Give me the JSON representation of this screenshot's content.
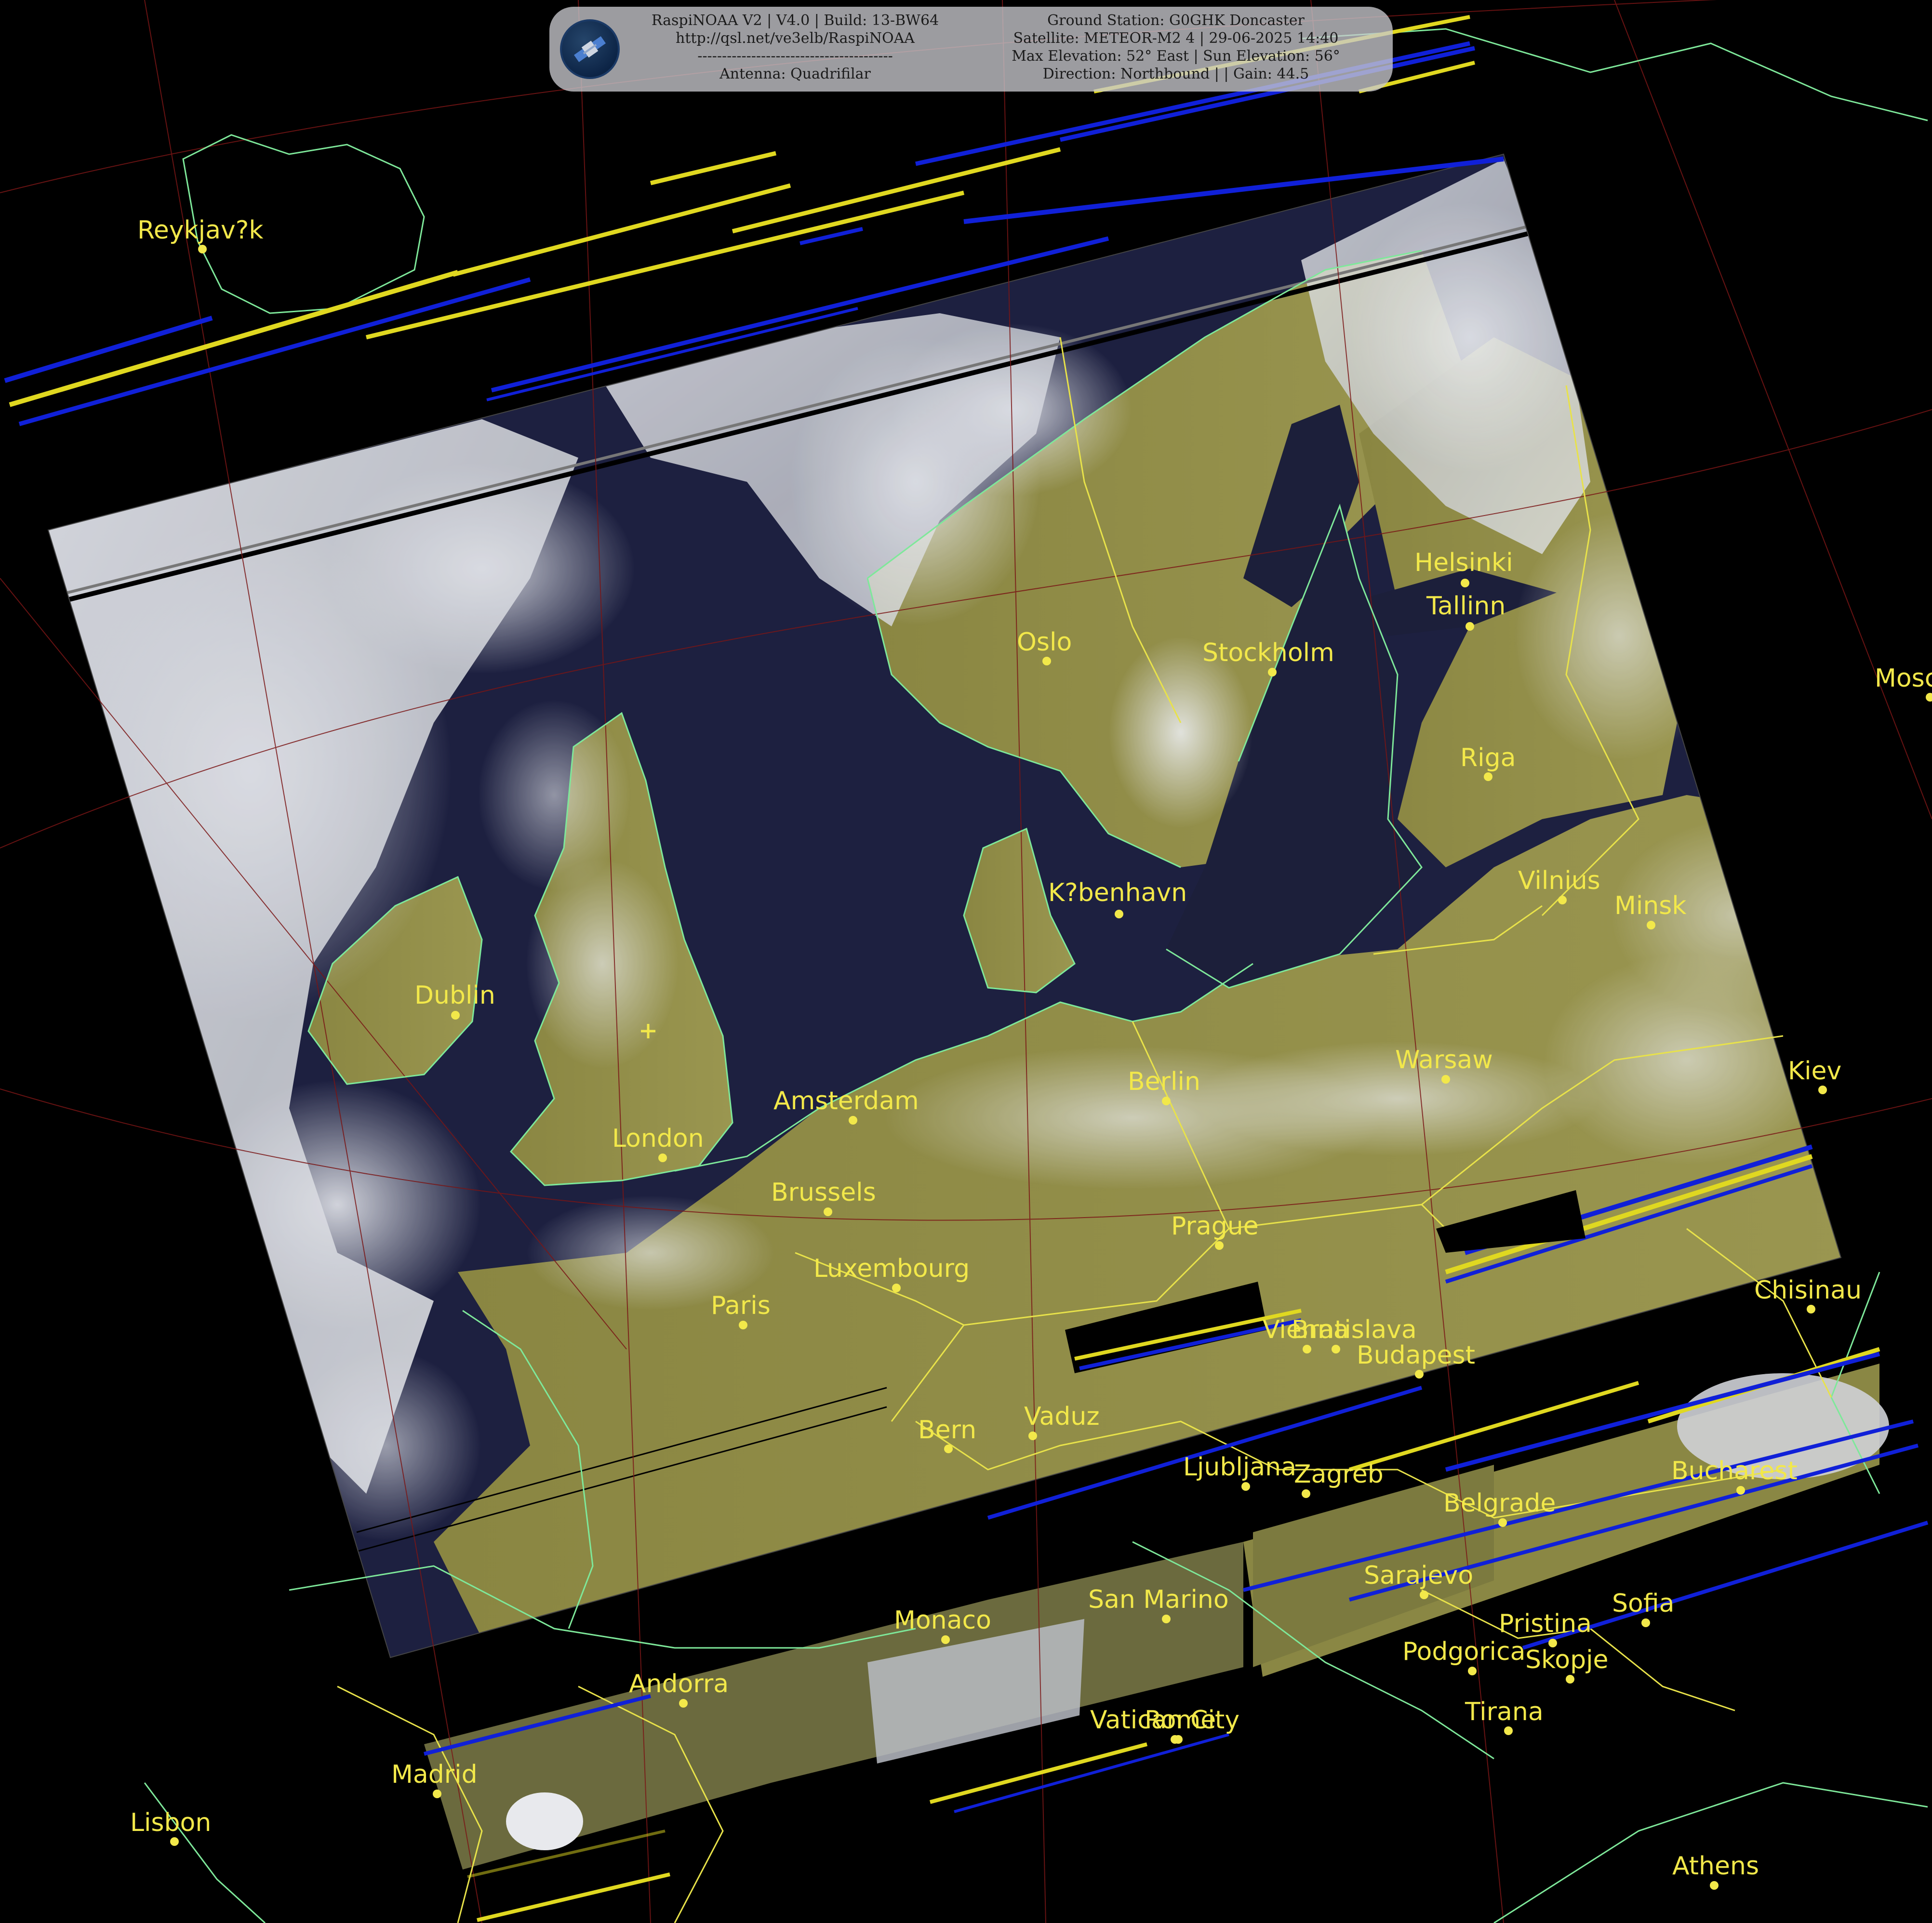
{
  "header": {
    "left_lines": [
      "RaspiNOAA V2 | V4.0 | Build: 13-BW64",
      "http://qsl.net/ve3elb/RaspiNOAA",
      "----------------------------------------",
      "Antenna: Quadrifilar"
    ],
    "right_lines": [
      "Ground Station: G0GHK Doncaster",
      "Satellite: METEOR-M2 4 | 29-06-2025 14:40",
      "Max Elevation: 52° East | Sun Elevation: 56°",
      "Direction: Northbound | | Gain: 44.5"
    ],
    "logo_icon": "satellite-icon"
  },
  "cities": [
    {
      "name": "Reykjav?k"
    },
    {
      "name": "Helsinki"
    },
    {
      "name": "Tallinn"
    },
    {
      "name": "Oslo"
    },
    {
      "name": "Stockholm"
    },
    {
      "name": "Mosc"
    },
    {
      "name": "Riga"
    },
    {
      "name": "Vilnius"
    },
    {
      "name": "Minsk"
    },
    {
      "name": "K?benhavn"
    },
    {
      "name": "Dublin"
    },
    {
      "name": "Warsaw"
    },
    {
      "name": "Kiev"
    },
    {
      "name": "Amsterdam"
    },
    {
      "name": "Berlin"
    },
    {
      "name": "London"
    },
    {
      "name": "Brussels"
    },
    {
      "name": "Prague"
    },
    {
      "name": "Luxembourg"
    },
    {
      "name": "Chisinau"
    },
    {
      "name": "Paris"
    },
    {
      "name": "Vienna"
    },
    {
      "name": "Bratislava"
    },
    {
      "name": "Budapest"
    },
    {
      "name": "Bern"
    },
    {
      "name": "Vaduz"
    },
    {
      "name": "Ljubljana"
    },
    {
      "name": "Zagreb"
    },
    {
      "name": "Bucharest"
    },
    {
      "name": "Belgrade"
    },
    {
      "name": "Sarajevo"
    },
    {
      "name": "Monaco"
    },
    {
      "name": "San Marino"
    },
    {
      "name": "Sofia"
    },
    {
      "name": "Pristina"
    },
    {
      "name": "Podgorica"
    },
    {
      "name": "Skopje"
    },
    {
      "name": "Andorra"
    },
    {
      "name": "Tirana"
    },
    {
      "name": "Vatican City"
    },
    {
      "name": "Rome"
    },
    {
      "name": "Madrid"
    },
    {
      "name": "Lisbon"
    },
    {
      "name": "Athens"
    }
  ],
  "colors": {
    "city_label": "#f2e84a",
    "coastline": "#7ee89a",
    "border": "#e8e24a",
    "graticule": "#8a1a1a",
    "land": "#8c8a46",
    "sea": "#1c1f3a",
    "cloud": "#d8dadf",
    "noise_blue": "#1020d8",
    "noise_yellow": "#e0d820"
  }
}
